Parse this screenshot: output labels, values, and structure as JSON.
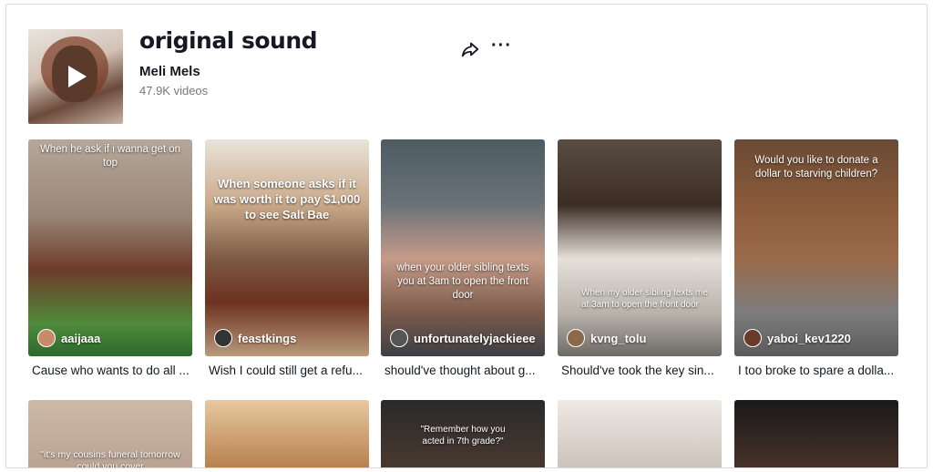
{
  "sound": {
    "title": "original sound",
    "author": "Meli Mels",
    "video_count": "47.9K videos"
  },
  "icons": {
    "share": "share-arrow-icon",
    "more": "more-dots-icon",
    "play": "play-icon"
  },
  "videos": [
    {
      "overlay": "When he ask if i wanna get on top",
      "username": "aaijaaa",
      "caption": "Cause who wants to do all ..."
    },
    {
      "overlay": "When someone asks if it was worth it to pay $1,000 to see Salt Bae",
      "username": "feastkings",
      "caption": "Wish I could still get a refu..."
    },
    {
      "overlay": "when your older sibling texts you at 3am to open the front door",
      "username": "unfortunatelyjackieee",
      "caption": "should've thought about g..."
    },
    {
      "overlay": "When my older sibling texts me at 3am to open the front door",
      "username": "kvng_tolu",
      "caption": "Should've took the key sin..."
    },
    {
      "overlay": "Would you like to donate a dollar to starving children?",
      "username": "yaboi_kev1220",
      "caption": "I too broke to spare a dolla..."
    }
  ],
  "videos_row2": [
    {
      "overlay": "\"it's my cousins funeral tomorrow could you cover"
    },
    {
      "overlay": ""
    },
    {
      "overlay": "\"Remember how you acted in 7th grade?\""
    },
    {
      "overlay": ""
    },
    {
      "overlay": ""
    }
  ]
}
